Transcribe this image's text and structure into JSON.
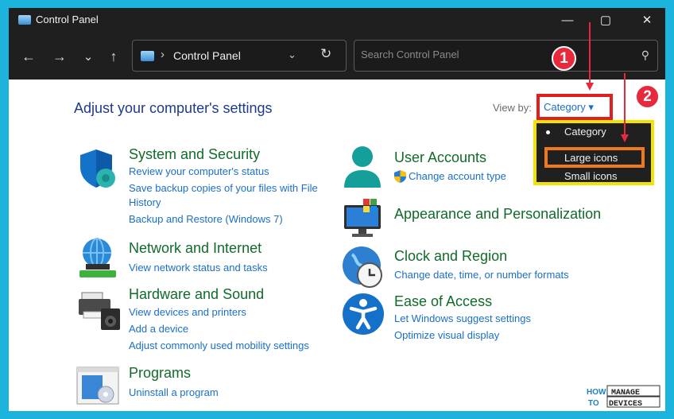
{
  "window": {
    "title": "Control Panel",
    "minimize": "—",
    "maximize": "▢",
    "close": "✕"
  },
  "nav": {
    "back": "←",
    "forward": "→",
    "recent": "⌄",
    "up": "↑",
    "address_crumb": "Control Panel",
    "address_sep": "›",
    "address_dropdown": "⌄",
    "refresh": "↻",
    "search_placeholder": "Search Control Panel",
    "search_icon": "⚲"
  },
  "main": {
    "heading": "Adjust your computer's settings",
    "view_by_label": "View by:",
    "view_by_value": "Category ▾"
  },
  "view_menu": {
    "items": [
      "Category",
      "Large icons",
      "Small icons"
    ],
    "selected": "Category"
  },
  "categories_left": [
    {
      "title": "System and Security",
      "icon": "shield-icon",
      "links": [
        "Review your computer's status",
        "Save backup copies of your files with File",
        "History",
        "Backup and Restore (Windows 7)"
      ]
    },
    {
      "title": "Network and Internet",
      "icon": "globe-network-icon",
      "links": [
        "View network status and tasks"
      ]
    },
    {
      "title": "Hardware and Sound",
      "icon": "printer-speaker-icon",
      "links": [
        "View devices and printers",
        "Add a device",
        "Adjust commonly used mobility settings"
      ]
    },
    {
      "title": "Programs",
      "icon": "programs-disc-icon",
      "links": [
        "Uninstall a program"
      ]
    }
  ],
  "categories_right": [
    {
      "title": "User Accounts",
      "icon": "user-icon",
      "links": [
        "Change account type"
      ]
    },
    {
      "title": "Appearance and Personalization",
      "icon": "monitor-palette-icon",
      "links": []
    },
    {
      "title": "Clock and Region",
      "icon": "globe-clock-icon",
      "links": [
        "Change date, time, or number formats"
      ]
    },
    {
      "title": "Ease of Access",
      "icon": "accessibility-icon",
      "links": [
        "Let Windows suggest settings",
        "Optimize visual display"
      ]
    }
  ],
  "annotations": {
    "badge1": "1",
    "badge2": "2"
  },
  "watermark": {
    "how": "HOW",
    "to": "TO",
    "manage": "MANAGE",
    "devices": "DEVICES"
  },
  "colors": {
    "frame": "#1cb4dc",
    "title_bar": "#1f1f1f",
    "heading": "#1e3a8a",
    "category_title": "#106b2a",
    "link": "#1a6fc9",
    "highlight_red": "#e02020",
    "highlight_yellow": "#f3e400",
    "highlight_orange": "#ef7a1a",
    "badge": "#e8283c"
  }
}
